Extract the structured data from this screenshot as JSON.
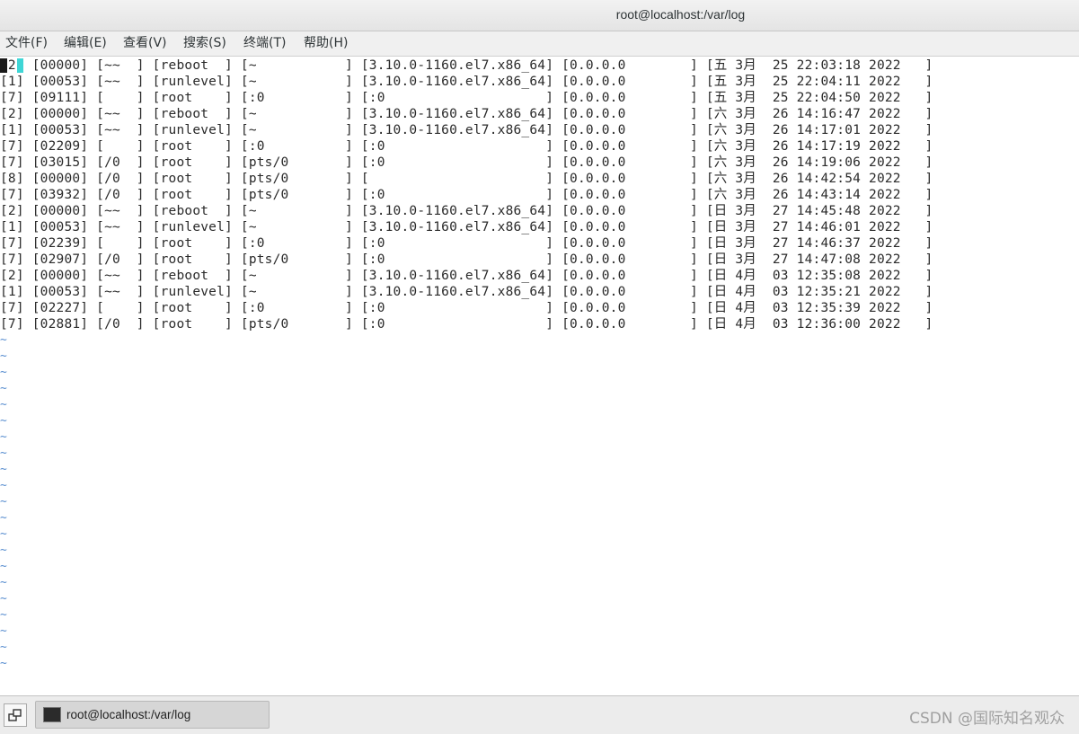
{
  "window": {
    "title": "root@localhost:/var/log"
  },
  "menu": [
    "文件(F)",
    "编辑(E)",
    "查看(V)",
    "搜索(S)",
    "终端(T)",
    "帮助(H)"
  ],
  "terminal": {
    "lines": [
      "[2] [00000] [~~  ] [reboot  ] [~           ] [3.10.0-1160.el7.x86_64] [0.0.0.0        ] [五 3月  25 22:03:18 2022   ]",
      "[1] [00053] [~~  ] [runlevel] [~           ] [3.10.0-1160.el7.x86_64] [0.0.0.0        ] [五 3月  25 22:04:11 2022   ]",
      "[7] [09111] [    ] [root    ] [:0          ] [:0                    ] [0.0.0.0        ] [五 3月  25 22:04:50 2022   ]",
      "[2] [00000] [~~  ] [reboot  ] [~           ] [3.10.0-1160.el7.x86_64] [0.0.0.0        ] [六 3月  26 14:16:47 2022   ]",
      "[1] [00053] [~~  ] [runlevel] [~           ] [3.10.0-1160.el7.x86_64] [0.0.0.0        ] [六 3月  26 14:17:01 2022   ]",
      "[7] [02209] [    ] [root    ] [:0          ] [:0                    ] [0.0.0.0        ] [六 3月  26 14:17:19 2022   ]",
      "[7] [03015] [/0  ] [root    ] [pts/0       ] [:0                    ] [0.0.0.0        ] [六 3月  26 14:19:06 2022   ]",
      "[8] [00000] [/0  ] [root    ] [pts/0       ] [                      ] [0.0.0.0        ] [六 3月  26 14:42:54 2022   ]",
      "[7] [03932] [/0  ] [root    ] [pts/0       ] [:0                    ] [0.0.0.0        ] [六 3月  26 14:43:14 2022   ]",
      "[2] [00000] [~~  ] [reboot  ] [~           ] [3.10.0-1160.el7.x86_64] [0.0.0.0        ] [日 3月  27 14:45:48 2022   ]",
      "[1] [00053] [~~  ] [runlevel] [~           ] [3.10.0-1160.el7.x86_64] [0.0.0.0        ] [日 3月  27 14:46:01 2022   ]",
      "[7] [02239] [    ] [root    ] [:0          ] [:0                    ] [0.0.0.0        ] [日 3月  27 14:46:37 2022   ]",
      "[7] [02907] [/0  ] [root    ] [pts/0       ] [:0                    ] [0.0.0.0        ] [日 3月  27 14:47:08 2022   ]",
      "[2] [00000] [~~  ] [reboot  ] [~           ] [3.10.0-1160.el7.x86_64] [0.0.0.0        ] [日 4月  03 12:35:08 2022   ]",
      "[1] [00053] [~~  ] [runlevel] [~           ] [3.10.0-1160.el7.x86_64] [0.0.0.0        ] [日 4月  03 12:35:21 2022   ]",
      "[7] [02227] [    ] [root    ] [:0          ] [:0                    ] [0.0.0.0        ] [日 4月  03 12:35:39 2022   ]",
      "[7] [02881] [/0  ] [root    ] [pts/0       ] [:0                    ] [0.0.0.0        ] [日 4月  03 12:36:00 2022   ]"
    ],
    "tilde_char": "~",
    "tilde_count": 21
  },
  "taskbar": {
    "task_label": "root@localhost:/var/log",
    "watermark": "CSDN @国际知名观众"
  },
  "colors": {
    "cursor_cyan": "#3fd6d6",
    "tilde_blue": "#5a8fd0"
  }
}
